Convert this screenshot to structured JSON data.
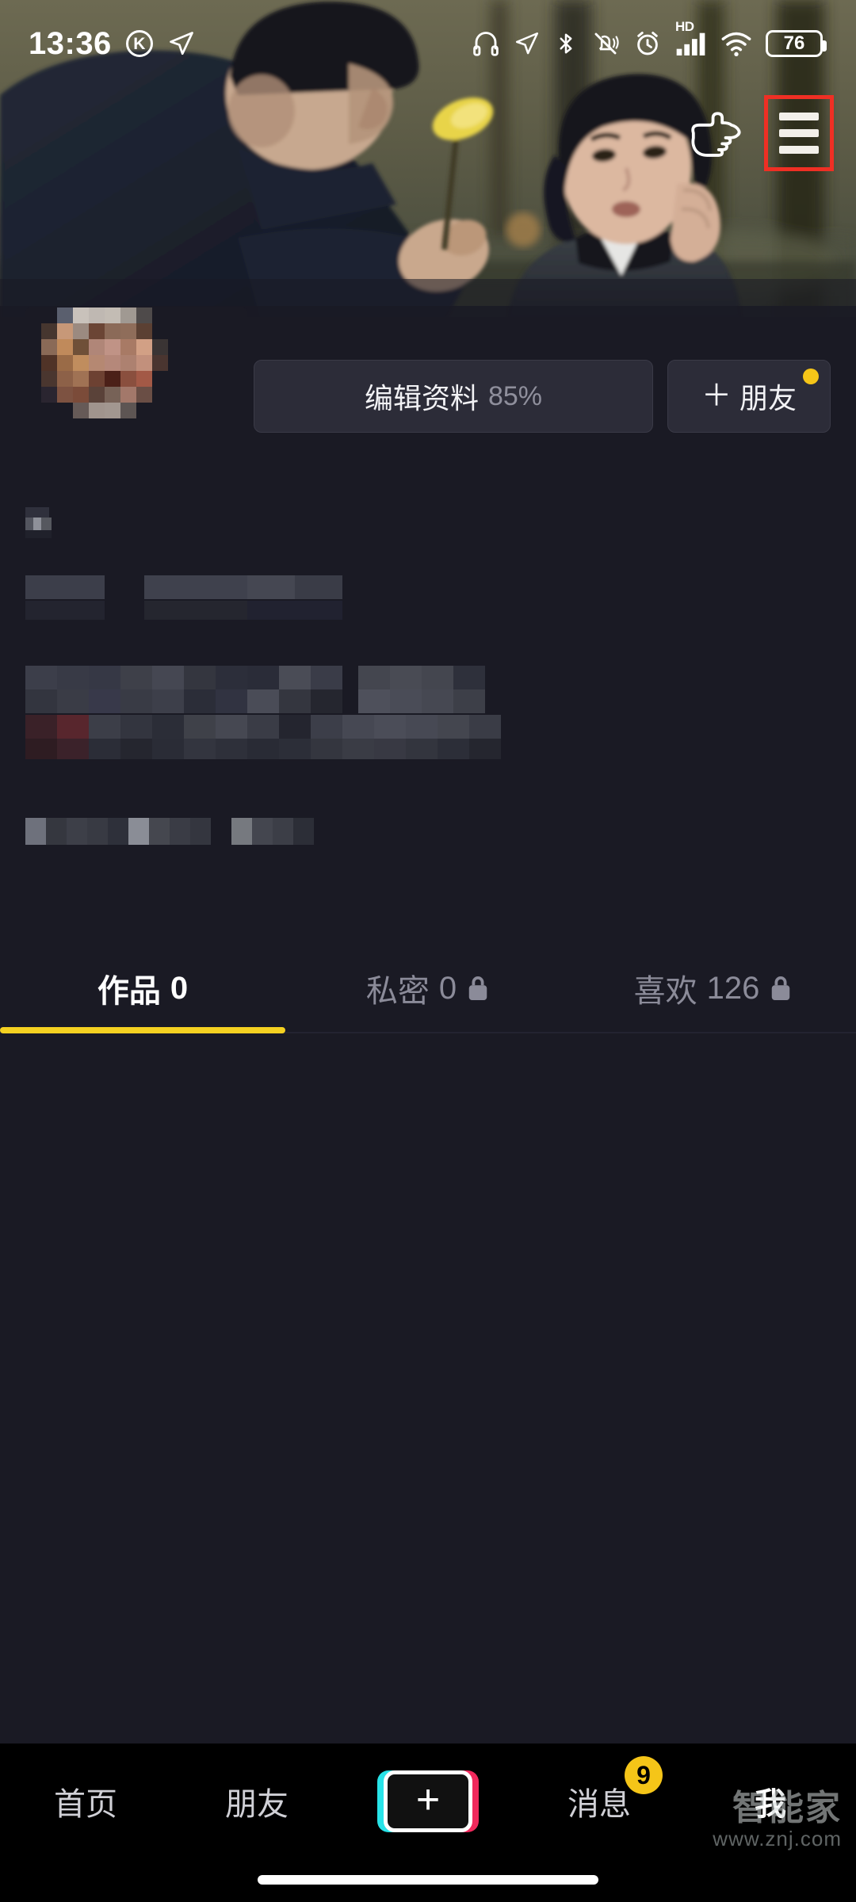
{
  "status_bar": {
    "time": "13:36",
    "k_badge": "K",
    "battery_level": "76",
    "hd_label": "HD",
    "icons": [
      "headphones-icon",
      "location-arrow-icon",
      "bluetooth-icon",
      "mute-bell-icon",
      "alarm-clock-icon",
      "hd-signal-icon",
      "wifi-icon",
      "battery-icon"
    ]
  },
  "hero": {
    "description": "park-scene-banner",
    "hand_icon": "pointing-hand-icon",
    "menu_icon": "hamburger-menu-icon",
    "highlight_color": "#ef2f24"
  },
  "profile": {
    "avatar": "mosaic-avatar",
    "edit_button": {
      "label": "编辑资料",
      "percent": "85%"
    },
    "friend_button": {
      "plus": "＋",
      "label": "朋友",
      "badge_color": "#f5c518"
    },
    "name_redacted": "mosaic-name",
    "meta_redacted": "mosaic-meta",
    "bio_redacted": "mosaic-bio",
    "tags_redacted": "mosaic-tags"
  },
  "tabs": [
    {
      "label": "作品",
      "count": "0",
      "locked": false,
      "active": true
    },
    {
      "label": "私密",
      "count": "0",
      "locked": true,
      "active": false
    },
    {
      "label": "喜欢",
      "count": "126",
      "locked": true,
      "active": false
    }
  ],
  "tab_accent": "#f5d121",
  "bottom_nav": {
    "items": [
      {
        "label": "首页",
        "active": false,
        "badge": null
      },
      {
        "label": "朋友",
        "active": false,
        "badge": null
      },
      {
        "label": "",
        "active": false,
        "badge": null,
        "is_plus": true
      },
      {
        "label": "消息",
        "active": false,
        "badge": "9"
      },
      {
        "label": "我",
        "active": true,
        "badge": null
      }
    ],
    "plus_symbol": "+",
    "plus_colors": {
      "cyan": "#28e3e8",
      "pink": "#f0295c"
    }
  },
  "watermark": {
    "brand": "智能家",
    "url": "www.znj.com"
  }
}
